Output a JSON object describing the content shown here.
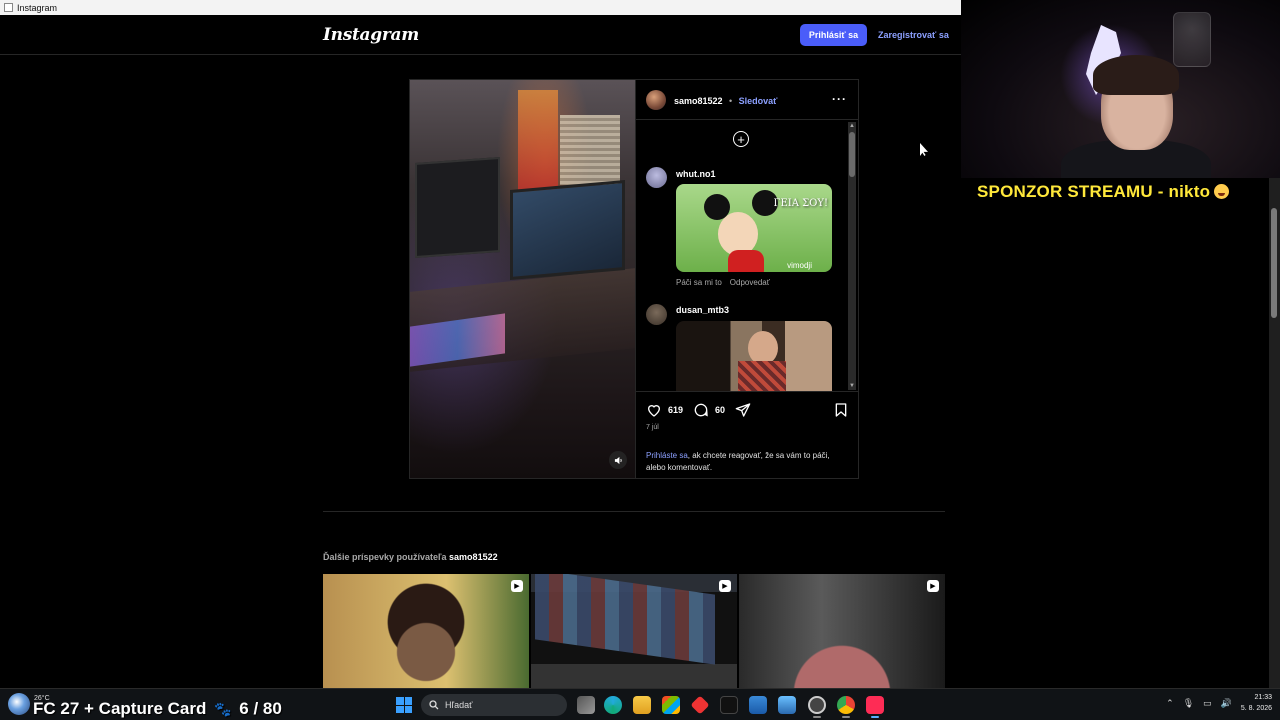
{
  "window": {
    "title": "Instagram"
  },
  "instagram": {
    "logo": "Instagram",
    "login_button": "Prihlásiť sa",
    "register_link": "Zaregistrovať sa",
    "post": {
      "username": "samo81522",
      "separator": "•",
      "follow_label": "Sledovať",
      "more_icon": "more-horizontal-icon",
      "add_comment_icon": "plus-circle-icon",
      "comments": [
        {
          "username": "whut.no1",
          "gif_caption": "ΓΕΙΑ ΣΟΥ!",
          "gif_watermark": "vimodji",
          "like_label": "Páči sa mi to",
          "reply_label": "Odpovedať"
        },
        {
          "username": "dusan_mtb3"
        }
      ],
      "likes": "619",
      "comments_count": "60",
      "date": "7 júl",
      "login_prompt_link": "Prihláste sa",
      "login_prompt_rest": ", ak chcete reagovať, že sa vám to páči, alebo komentovať."
    },
    "more_posts": {
      "prefix": "Ďalšie príspevky používateľa",
      "username": "samo81522",
      "tiles": [
        {
          "type": "reel"
        },
        {
          "type": "reel"
        },
        {
          "type": "reel"
        }
      ]
    }
  },
  "stream_overlay": {
    "sponsor_text": "SPONZOR STREAMU - nikto",
    "bottom_text_left": "FC 27 + Capture Card",
    "bottom_text_right": "6 / 80"
  },
  "taskbar": {
    "temperature": "26°C",
    "search_placeholder": "Hľadať",
    "time": "21:33",
    "date": "5. 8. 2026",
    "accent": "#3aa0ff"
  },
  "colors": {
    "ig_blue": "#4a5df9",
    "ig_link": "#8ca0ff",
    "sponsor_yellow": "#ffe83a"
  }
}
